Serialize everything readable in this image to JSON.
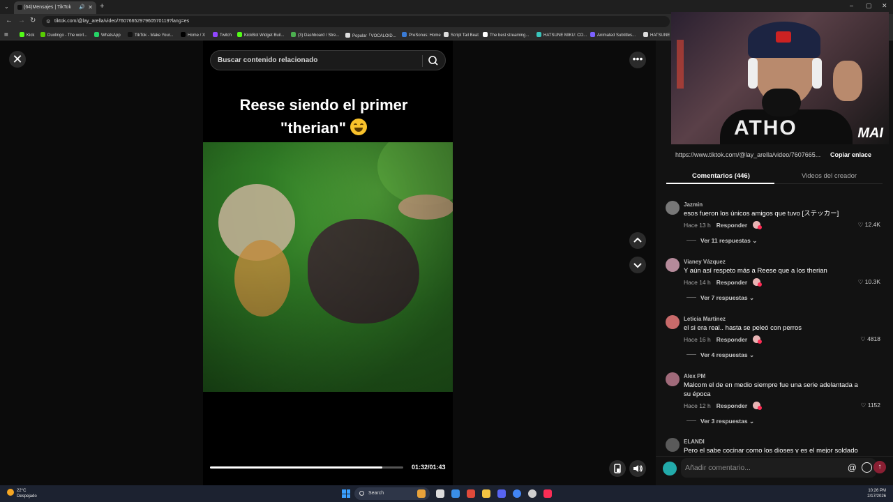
{
  "browser": {
    "tab_title": "(64)Mensajes | TikTok",
    "url": "tiktok.com/@lay_arella/video/7607665297960570119?lang=es",
    "bookmarks": [
      {
        "label": "Kick",
        "color": "#53fc18"
      },
      {
        "label": "Duolingo - The worl...",
        "color": "#58cc02"
      },
      {
        "label": "WhatsApp",
        "color": "#25d366"
      },
      {
        "label": "TikTok - Make Your...",
        "color": "#111111"
      },
      {
        "label": "Home / X",
        "color": "#000000"
      },
      {
        "label": "Twitch",
        "color": "#9146ff"
      },
      {
        "label": "KickBot Widget Buil...",
        "color": "#53fc18"
      },
      {
        "label": "(3) Dashboard / Stre...",
        "color": "#4caf50"
      },
      {
        "label": "Popular「VOCALOID...",
        "color": "#dddddd"
      },
      {
        "label": "PreSonus: Home",
        "color": "#3a7bd5"
      },
      {
        "label": "Script Tail Beat",
        "color": "#dddddd"
      },
      {
        "label": "The best streaming...",
        "color": "#ffffff"
      },
      {
        "label": "HATSUNE MIKU: CO...",
        "color": "#39c5bb"
      },
      {
        "label": "Animated Subtitles...",
        "color": "#7b61ff"
      },
      {
        "label": "HATSUNE M",
        "color": "#dddddd"
      }
    ]
  },
  "player": {
    "search_placeholder": "Buscar contenido relacionado",
    "caption_line1": "Reese siendo el primer",
    "caption_line2": "\"therian\"",
    "time": "01:32/01:43",
    "progress": 0.89
  },
  "panel": {
    "share_url": "https://www.tiktok.com/@lay_arella/video/7607665...",
    "copy_label": "Copiar enlace",
    "webcam_logo": "MAI",
    "tabs": [
      "Comentarios (446)",
      "Videos del creador"
    ],
    "reply_label": "Responder",
    "comments": [
      {
        "user": "Jazmin",
        "text": "esos fueron los únicos amigos que tuvo [ステッカー]",
        "time": "Hace 13 h",
        "likes": "12.4K",
        "replies": "Ver 11 respuestas",
        "avatar_color": "#777777"
      },
      {
        "user": "Vianey Vázquez",
        "text": "Y aún así respeto más a Reese que a los therian",
        "time": "Hace 14 h",
        "likes": "10.3K",
        "replies": "Ver 7 respuestas",
        "avatar_color": "#b58a9a"
      },
      {
        "user": "Leticia Martinez",
        "text": "el si era real.. hasta se peleó con perros",
        "time": "Hace 16 h",
        "likes": "4818",
        "replies": "Ver 4 respuestas",
        "avatar_color": "#c86a6a"
      },
      {
        "user": "Alex PM",
        "text": "Malcom el de en medio siempre fue una serie adelantada a su época",
        "time": "Hace 12 h",
        "likes": "1152",
        "replies": "Ver 3 respuestas",
        "avatar_color": "#a06a7a"
      },
      {
        "user": "ELANDI",
        "text": "Pero el sabe cocinar como los dioses y es el mejor soldado",
        "avatar_color": "#5a5a5a"
      }
    ],
    "comment_placeholder": "Añadir comentario..."
  },
  "taskbar": {
    "temp": "22°C",
    "weather": "Despejado",
    "search": "Search",
    "time": "10:26 PM",
    "date": "2/17/2026"
  }
}
